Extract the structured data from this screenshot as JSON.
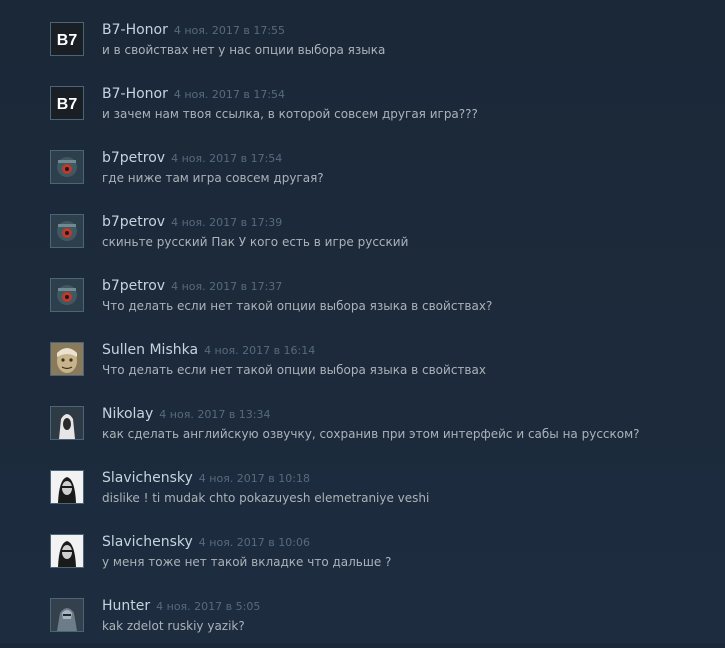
{
  "colors": {
    "background": "#1b2838",
    "author": "#c6d4df",
    "timestamp": "#566b7d",
    "text": "#acb2b8"
  },
  "comments": [
    {
      "author": "B7-Honor",
      "timestamp": "4 ноя. 2017 в 17:55",
      "text": "и в свойствах нет у нас опции выбора языка",
      "avatar": "b7-logo-avatar",
      "avatar_text": "B7"
    },
    {
      "author": "B7-Honor",
      "timestamp": "4 ноя. 2017 в 17:54",
      "text": "и зачем нам твоя ссылка, в которой совсем другая игра???",
      "avatar": "b7-logo-avatar",
      "avatar_text": "B7"
    },
    {
      "author": "b7petrov",
      "timestamp": "4 ноя. 2017 в 17:54",
      "text": "где ниже там игра совсем другая?",
      "avatar": "robot-avatar"
    },
    {
      "author": "b7petrov",
      "timestamp": "4 ноя. 2017 в 17:39",
      "text": "скиньте русский Пак У кого есть в игре русский",
      "avatar": "robot-avatar"
    },
    {
      "author": "b7petrov",
      "timestamp": "4 ноя. 2017 в 17:37",
      "text": "Что делать если нет такой опции выбора языка в свойствах?",
      "avatar": "robot-avatar"
    },
    {
      "author": "Sullen Mishka",
      "timestamp": "4 ноя. 2017 в 16:14",
      "text": "Что делать если нет такой опции выбора языка в свойствах",
      "avatar": "face-avatar"
    },
    {
      "author": "Nikolay",
      "timestamp": "4 ноя. 2017 в 13:34",
      "text": "как сделать английскую озвучку, сохранив при этом интерфейс и сабы на русском?",
      "avatar": "hooded-figure-avatar"
    },
    {
      "author": "Slavichensky",
      "timestamp": "4 ноя. 2017 в 10:18",
      "text": "dislike ! ti mudak chto pokazuyesh elemetraniye veshi",
      "avatar": "masked-face-avatar"
    },
    {
      "author": "Slavichensky",
      "timestamp": "4 ноя. 2017 в 10:06",
      "text": "у меня тоже нет такой вкладке что дальше ?",
      "avatar": "masked-face-avatar"
    },
    {
      "author": "Hunter",
      "timestamp": "4 ноя. 2017 в 5:05",
      "text": "kak zdelot ruskiy yazik?",
      "avatar": "armored-figure-avatar"
    }
  ]
}
